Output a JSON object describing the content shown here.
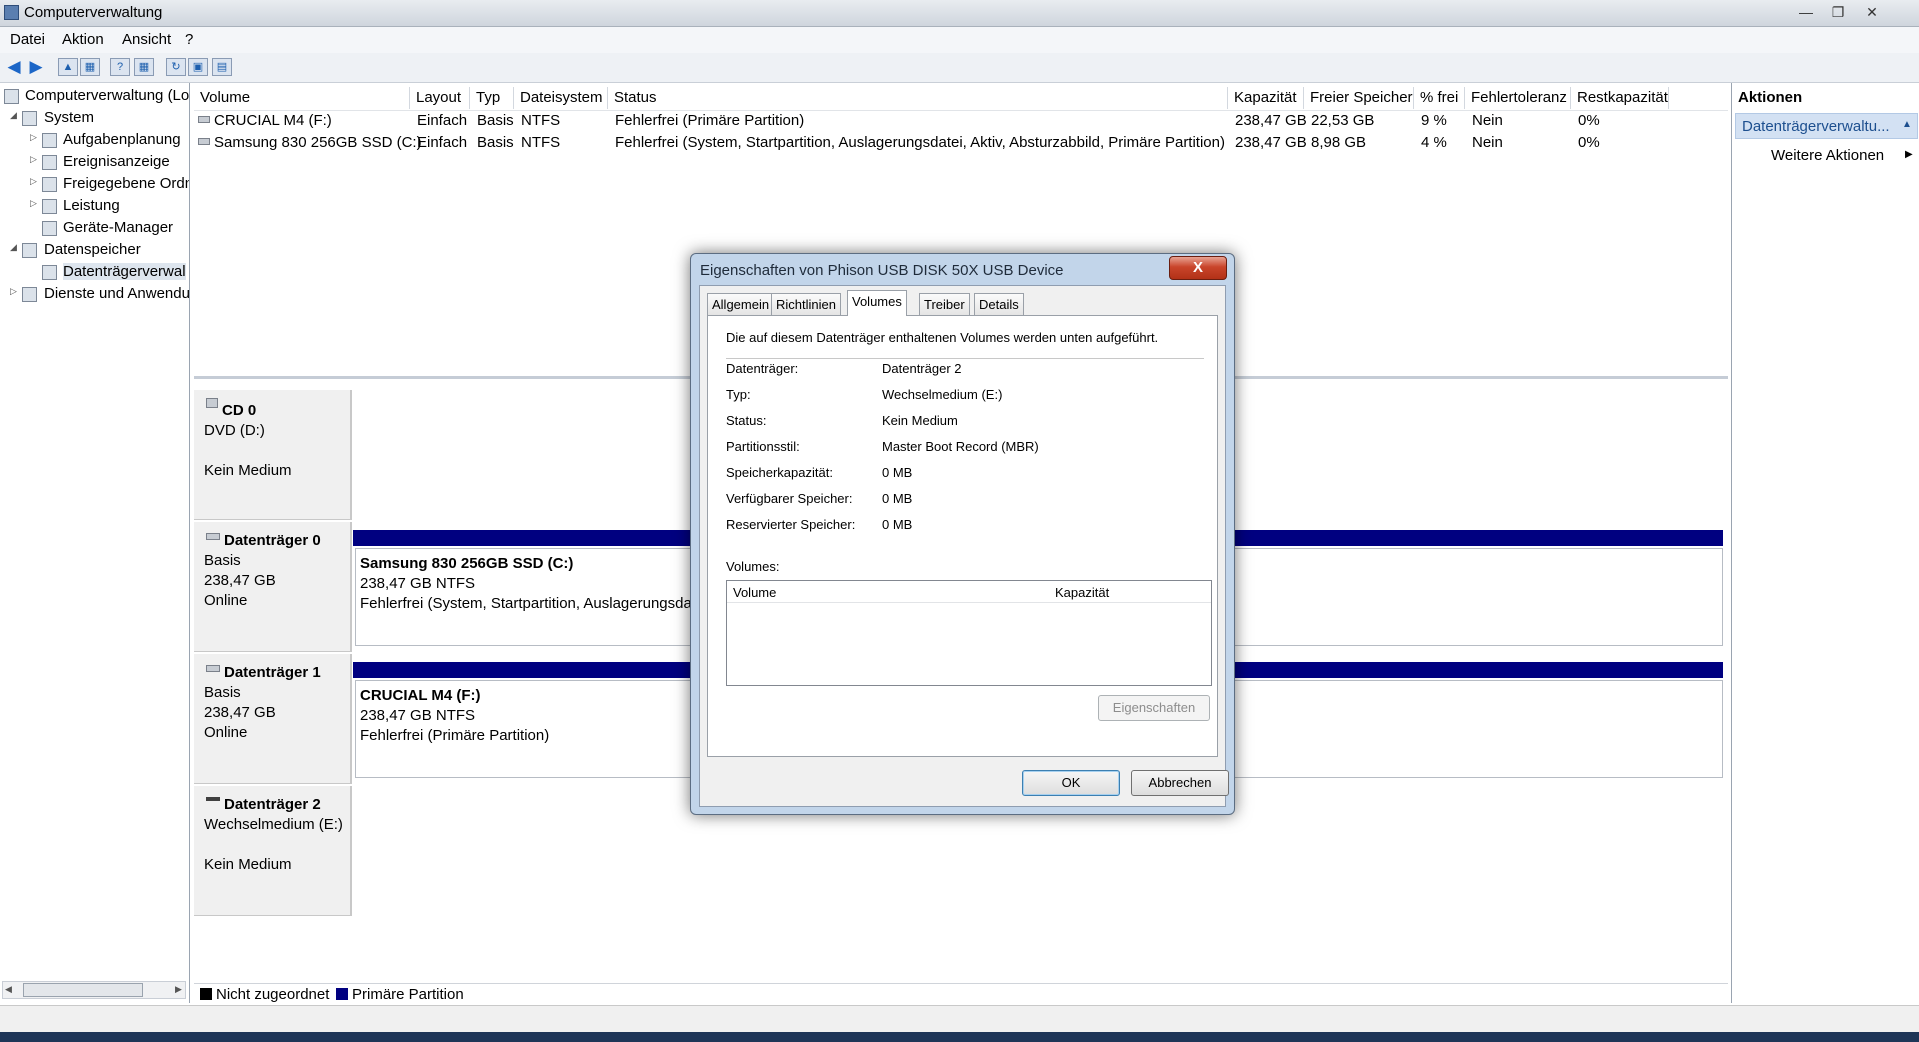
{
  "window": {
    "title": "Computerverwaltung"
  },
  "menu": {
    "items": [
      "Datei",
      "Aktion",
      "Ansicht",
      "?"
    ]
  },
  "tree": {
    "items": [
      {
        "label": "Computerverwaltung (Lo"
      },
      {
        "label": "System"
      },
      {
        "label": "Aufgabenplanung"
      },
      {
        "label": "Ereignisanzeige"
      },
      {
        "label": "Freigegebene Ordn"
      },
      {
        "label": "Leistung"
      },
      {
        "label": "Geräte-Manager"
      },
      {
        "label": "Datenspeicher"
      },
      {
        "label": "Datenträgerverwal"
      },
      {
        "label": "Dienste und Anwendu"
      }
    ]
  },
  "volumes": {
    "columns": [
      "Volume",
      "Layout",
      "Typ",
      "Dateisystem",
      "Status",
      "Kapazität",
      "Freier Speicher",
      "% frei",
      "Fehlertoleranz",
      "Restkapazität"
    ],
    "rows": [
      [
        "CRUCIAL M4 (F:)",
        "Einfach",
        "Basis",
        "NTFS",
        "Fehlerfrei (Primäre Partition)",
        "238,47 GB",
        "22,53 GB",
        "9 %",
        "Nein",
        "0%"
      ],
      [
        "Samsung 830 256GB SSD (C:)",
        "Einfach",
        "Basis",
        "NTFS",
        "Fehlerfrei (System, Startpartition, Auslagerungsdatei, Aktiv, Absturzabbild, Primäre Partition)",
        "238,47 GB",
        "8,98 GB",
        "4 %",
        "Nein",
        "0%"
      ]
    ]
  },
  "disks": [
    {
      "name": "CD 0",
      "line1": "DVD (D:)",
      "line2": "",
      "line3": "Kein Medium"
    },
    {
      "name": "Datenträger 0",
      "line1": "Basis",
      "line2": "238,47 GB",
      "line3": "Online",
      "part_name": "Samsung 830 256GB SSD  (C:)",
      "part_size": "238,47 GB NTFS",
      "part_status": "Fehlerfrei (System, Startpartition, Auslagerungsdat"
    },
    {
      "name": "Datenträger 1",
      "line1": "Basis",
      "line2": "238,47 GB",
      "line3": "Online",
      "part_name": "CRUCIAL M4  (F:)",
      "part_size": "238,47 GB NTFS",
      "part_status": "Fehlerfrei (Primäre Partition)"
    },
    {
      "name": "Datenträger 2",
      "line1": "Wechselmedium (E:)",
      "line2": "",
      "line3": "Kein Medium"
    }
  ],
  "legend": [
    {
      "label": "Nicht zugeordnet",
      "color": "#000000"
    },
    {
      "label": "Primäre Partition",
      "color": "#000080"
    }
  ],
  "actions": {
    "header": "Aktionen",
    "section": "Datenträgerverwaltu...",
    "more": "Weitere Aktionen"
  },
  "dialog": {
    "title": "Eigenschaften von Phison USB DISK 50X USB Device",
    "close": "X",
    "tabs": [
      "Allgemein",
      "Richtlinien",
      "Volumes",
      "Treiber",
      "Details"
    ],
    "active_tab": "Volumes",
    "intro": "Die auf diesem Datenträger enthaltenen Volumes werden unten aufgeführt.",
    "props": [
      {
        "label": "Datenträger:",
        "value": "Datenträger 2"
      },
      {
        "label": "Typ:",
        "value": "Wechselmedium (E:)"
      },
      {
        "label": "Status:",
        "value": "Kein Medium"
      },
      {
        "label": "Partitionsstil:",
        "value": "Master Boot Record (MBR)"
      },
      {
        "label": "Speicherkapazität:",
        "value": "0 MB"
      },
      {
        "label": "Verfügbarer Speicher:",
        "value": "0 MB"
      },
      {
        "label": "Reservierter Speicher:",
        "value": "0 MB"
      }
    ],
    "volumes_label": "Volumes:",
    "list_cols": [
      "Volume",
      "Kapazität"
    ],
    "btn_properties": "Eigenschaften",
    "btn_ok": "OK",
    "btn_cancel": "Abbrechen"
  }
}
